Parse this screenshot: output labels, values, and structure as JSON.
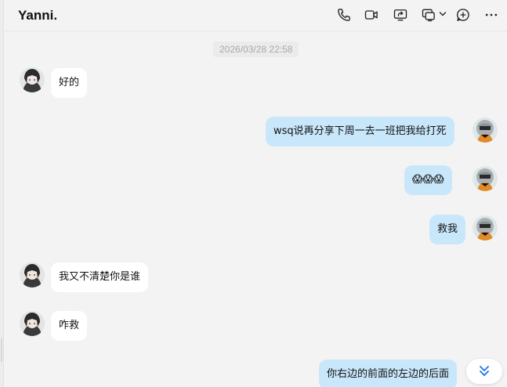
{
  "header": {
    "title": "Yanni.",
    "icons": [
      "phone-icon",
      "video-call-icon",
      "screen-share-icon",
      "remote-control-icon",
      "chevron-down-icon",
      "add-member-icon",
      "more-icon"
    ]
  },
  "timestamp": "2026/03/28 22:58",
  "messages": [
    {
      "side": "incoming",
      "text": "好的"
    },
    {
      "side": "outgoing",
      "text": "wsq说再分享下周一去一班把我给打死"
    },
    {
      "side": "outgoing",
      "text": "😱😱😱"
    },
    {
      "side": "outgoing",
      "text": "救我"
    },
    {
      "side": "incoming",
      "text": "我又不清楚你是谁"
    },
    {
      "side": "incoming",
      "text": "咋救"
    },
    {
      "side": "outgoing",
      "text": "你右边的前面的左边的后面"
    }
  ],
  "colors": {
    "background": "#f3f3f3",
    "incoming_bubble": "#ffffff",
    "outgoing_bubble": "#c9e7fb",
    "accent": "#1a73e8"
  },
  "scroll_to_bottom_icon": "double-chevron-down-icon"
}
